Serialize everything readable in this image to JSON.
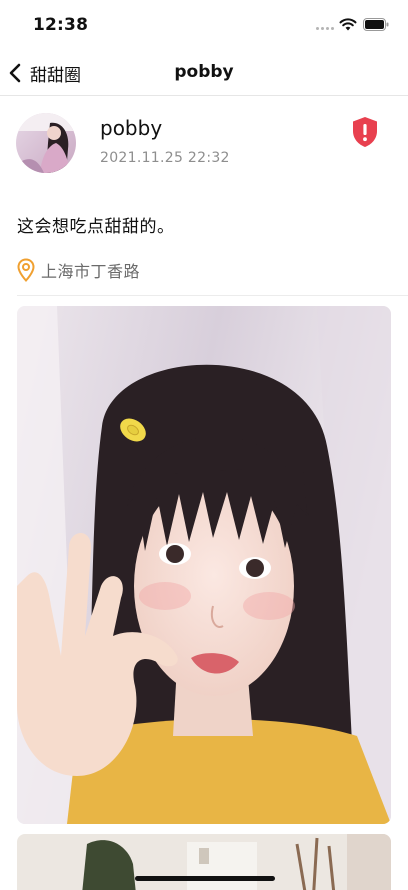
{
  "status_bar": {
    "time": "12:38"
  },
  "nav": {
    "back_label": "甜甜圈",
    "title": "pobby"
  },
  "post": {
    "username": "pobby",
    "timestamp": "2021.11.25  22:32",
    "text": "这会想吃点甜甜的。",
    "location": "上海市丁香路"
  },
  "colors": {
    "report_red": "#e8404f",
    "location_orange": "#f0a030",
    "muted_text": "#8e8e8e"
  },
  "icons": {
    "back": "chevron-left-icon",
    "report": "shield-alert-icon",
    "location": "location-pin-icon",
    "wifi": "wifi-icon",
    "battery": "battery-icon"
  }
}
